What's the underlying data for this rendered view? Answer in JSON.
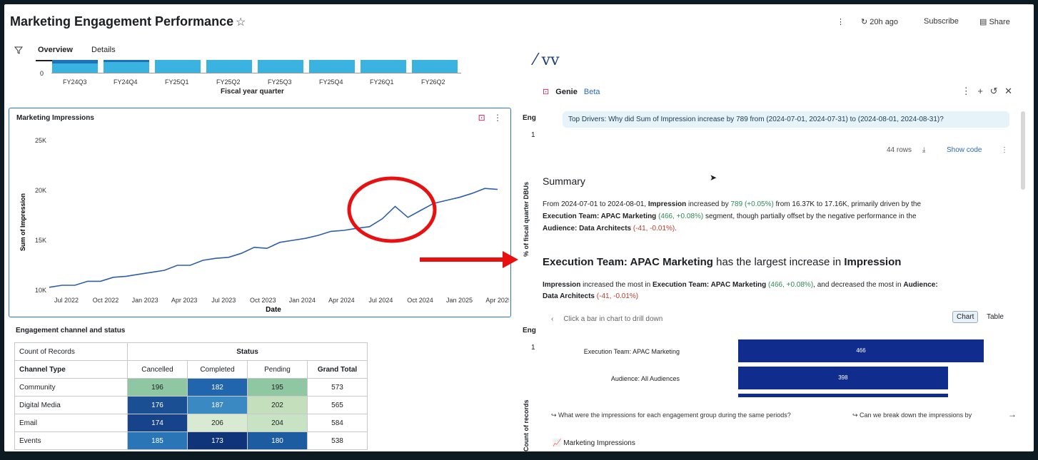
{
  "header": {
    "title": "Marketing Engagement Performance",
    "refresh": "20h ago",
    "subscribe": "Subscribe",
    "share": "Share"
  },
  "tabs": [
    {
      "label": "Overview"
    },
    {
      "label": "Details"
    }
  ],
  "top_chart": {
    "zero_label": "0",
    "quarters": [
      "FY24Q3",
      "FY24Q4",
      "FY25Q1",
      "FY25Q2",
      "FY25Q3",
      "FY25Q4",
      "FY26Q1",
      "FY26Q2"
    ],
    "xlabel": "Fiscal year quarter"
  },
  "impressions_panel": {
    "title": "Marketing Impressions"
  },
  "chart_data": {
    "type": "line",
    "title": "Marketing Impressions",
    "xlabel": "Date",
    "ylabel": "Sum of Impression",
    "ylim": [
      10000,
      25000
    ],
    "yticks": [
      "25K",
      "20K",
      "15K",
      "10K"
    ],
    "xticks": [
      "Jul 2022",
      "Oct 2022",
      "Jan 2023",
      "Apr 2023",
      "Jul 2023",
      "Oct 2023",
      "Jan 2024",
      "Apr 2024",
      "Jul 2024",
      "Oct 2024",
      "Jan 2025",
      "Apr 2025"
    ],
    "series": [
      {
        "x": [
          "2022-06",
          "2022-07",
          "2022-08",
          "2022-09",
          "2022-10",
          "2022-11",
          "2022-12",
          "2023-01",
          "2023-02",
          "2023-03",
          "2023-04",
          "2023-05",
          "2023-06",
          "2023-07",
          "2023-08",
          "2023-09",
          "2023-10",
          "2023-11",
          "2023-12",
          "2024-01",
          "2024-02",
          "2024-03",
          "2024-04",
          "2024-05",
          "2024-06",
          "2024-07",
          "2024-08",
          "2024-09",
          "2024-10",
          "2024-11",
          "2024-12",
          "2025-01",
          "2025-02",
          "2025-03",
          "2025-04",
          "2025-05"
        ],
        "values": [
          10300,
          10500,
          10500,
          10900,
          10900,
          11300,
          11400,
          11600,
          11800,
          12000,
          12500,
          12500,
          13000,
          13200,
          13300,
          13700,
          14300,
          14200,
          14800,
          15000,
          15200,
          15500,
          15900,
          16000,
          16200,
          16370,
          17160,
          18400,
          17300,
          18000,
          18700,
          19000,
          19300,
          19700,
          20200,
          20100
        ]
      }
    ],
    "grid": false
  },
  "annotation": {
    "circled": "Aug 2024 spike"
  },
  "engagement_table": {
    "title": "Engagement channel and status",
    "corner": "Count of Records",
    "status_header": "Status",
    "row_header": "Channel Type",
    "columns": [
      "Cancelled",
      "Completed",
      "Pending",
      "Grand Total"
    ],
    "rows": [
      {
        "name": "Community",
        "values": [
          "196",
          "182",
          "195",
          "573"
        ],
        "colors": [
          "#8fc7a3",
          "#2166ac",
          "#8fc7a3"
        ]
      },
      {
        "name": "Digital Media",
        "values": [
          "176",
          "187",
          "202",
          "565"
        ],
        "colors": [
          "#1a4f94",
          "#3a89c2",
          "#c3dfbc"
        ]
      },
      {
        "name": "Email",
        "values": [
          "174",
          "206",
          "204",
          "584"
        ],
        "colors": [
          "#17438a",
          "#d8ead1",
          "#c8e2c4"
        ]
      },
      {
        "name": "Events",
        "values": [
          "185",
          "173",
          "180",
          "538"
        ],
        "colors": [
          "#2a75b5",
          "#0f3479",
          "#1d5ca1"
        ]
      }
    ]
  },
  "middle_column": {
    "eng1": "Eng",
    "one1": "1",
    "eng2": "Eng",
    "one2": "1",
    "ylabel_top": "% of fiscal quarter DBUs",
    "ylabel_bottom": "Count of records"
  },
  "genie": {
    "name": "Genie",
    "badge": "Beta",
    "question": "Top Drivers: Why did Sum of Impression increase by 789 from (2024-07-01, 2024-07-31) to (2024-08-01, 2024-08-31)?",
    "rows": "44 rows",
    "show_code": "Show code",
    "summary_heading": "Summary",
    "summary": {
      "p1": "From 2024-07-01 to 2024-08-01, ",
      "b1": "Impression",
      "p2": " increased by ",
      "g1": "789",
      "g2": "(+0.05%)",
      "p3": " from 16.37K to 17.16K, primarily driven by the",
      "b2": "Execution Team: APAC Marketing",
      "g3": "(466, +0.08%)",
      "p4": " segment, though partially offset by the negative performance in the",
      "b3": "Audience: Data Architects",
      "r1": "(-41, -0.01%)",
      "p5": "."
    },
    "heading2": {
      "b1": "Execution Team: APAC Marketing",
      "t1": " has the largest increase in ",
      "b2": "Impression"
    },
    "detail": {
      "b1": "Impression",
      "t1": " increased the most in ",
      "b2": "Execution Team: APAC Marketing",
      "g1": "(466, +0.08%)",
      "t2": ", and decreased the most in ",
      "b3": "Audience:",
      "b4": "Data Architects",
      "r1": "(-41, -0.01%)"
    },
    "drill": "Click a bar in chart to drill down",
    "chart_btn": "Chart",
    "table_btn": "Table",
    "bars": [
      {
        "label": "Execution Team: APAC Marketing",
        "value": "466",
        "v": 466
      },
      {
        "label": "Audience: All Audiences",
        "value": "398",
        "v": 398
      }
    ],
    "suggestions": [
      "What were the impressions for each engagement group during the same periods?",
      "Can we break down the impressions by"
    ],
    "footer_item": "Marketing Impressions"
  }
}
